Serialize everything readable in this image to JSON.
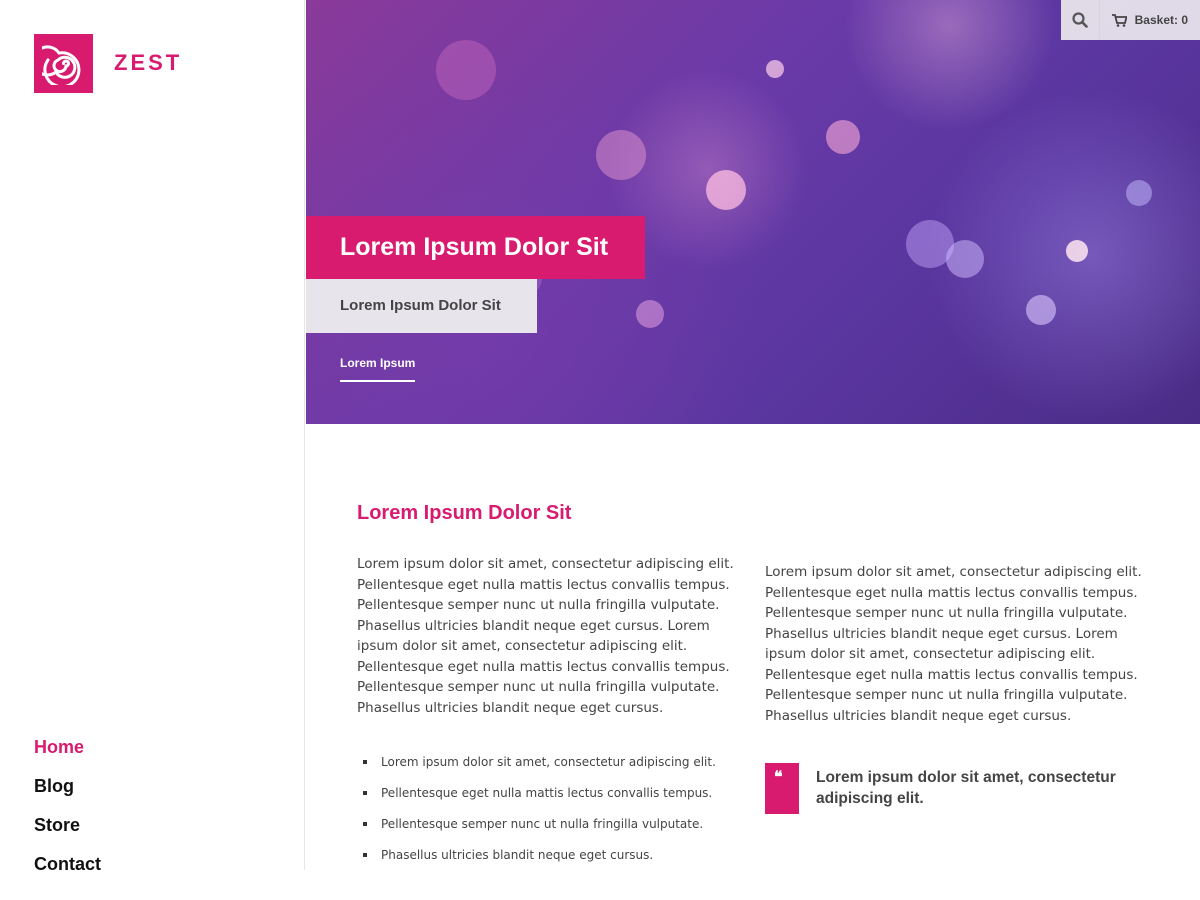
{
  "brand": {
    "name": "ZEST",
    "accent_color": "#d81b6f"
  },
  "nav": {
    "items": [
      {
        "label": "Home",
        "active": true
      },
      {
        "label": "Blog",
        "active": false
      },
      {
        "label": "Store",
        "active": false
      },
      {
        "label": "Contact",
        "active": false
      }
    ]
  },
  "utility": {
    "search_icon": "search-icon",
    "basket_icon": "shopping-cart-icon",
    "basket_label": "Basket: 0"
  },
  "hero": {
    "title": "Lorem Ipsum Dolor Sit",
    "subtitle": "Lorem Ipsum Dolor Sit",
    "link": "Lorem Ipsum"
  },
  "content": {
    "heading": "Lorem Ipsum Dolor Sit",
    "paragraph_left": "Lorem ipsum dolor sit amet, consectetur adipiscing elit. Pellentesque eget nulla mattis lectus convallis tempus. Pellentesque semper nunc ut nulla fringilla vulputate. Phasellus ultricies blandit neque eget cursus. Lorem ipsum dolor sit amet, consectetur adipiscing elit. Pellentesque eget nulla mattis lectus convallis tempus. Pellentesque semper nunc ut nulla fringilla vulputate. Phasellus ultricies blandit neque eget cursus.",
    "paragraph_right": "Lorem ipsum dolor sit amet, consectetur adipiscing elit. Pellentesque eget nulla mattis lectus convallis tempus. Pellentesque semper nunc ut nulla fringilla vulputate. Phasellus ultricies blandit neque eget cursus. Lorem ipsum dolor sit amet, consectetur adipiscing elit. Pellentesque eget nulla mattis lectus convallis tempus. Pellentesque semper nunc ut nulla fringilla vulputate. Phasellus ultricies blandit neque eget cursus.",
    "list": [
      "Lorem ipsum dolor sit amet, consectetur adipiscing elit.",
      "Pellentesque eget nulla mattis lectus convallis tempus.",
      "Pellentesque semper nunc ut nulla fringilla vulputate.",
      "Phasellus ultricies blandit neque eget cursus."
    ],
    "quote_mark": "❝",
    "quote": "Lorem ipsum dolor sit amet, consectetur adipiscing elit."
  }
}
